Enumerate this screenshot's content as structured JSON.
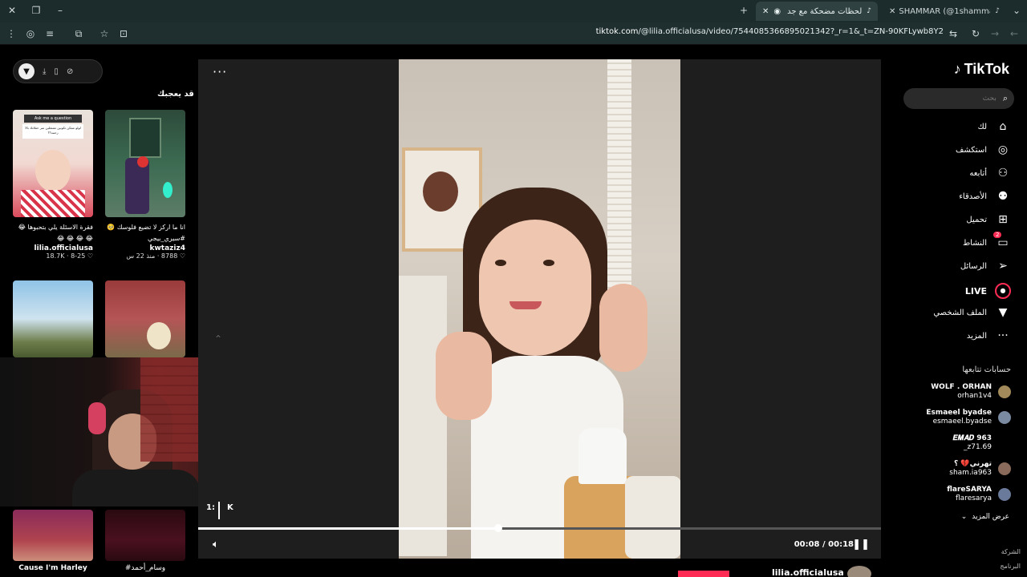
{
  "browser": {
    "tabs": [
      {
        "title": "SHAMMAR (@1shammar2) | Tik"
      },
      {
        "title": "لحظات مضحكة مع جد لولو ي"
      }
    ],
    "url_host": "tiktok.com",
    "url_path": "/@lilia.officialusa/video/7544085366895021342?_r=1&_t=ZN-90KFLywb8Y2"
  },
  "sidebar": {
    "logo": "TikTok",
    "search_placeholder": "بحث",
    "nav": [
      {
        "label": "لك",
        "icon": "home-icon"
      },
      {
        "label": "استكشف",
        "icon": "compass-icon"
      },
      {
        "label": "أتابعه",
        "icon": "user-follow-icon"
      },
      {
        "label": "الأصدقاء",
        "icon": "friends-icon"
      },
      {
        "label": "تحميل",
        "icon": "upload-icon"
      },
      {
        "label": "النشاط",
        "icon": "activity-icon",
        "badge": "2"
      },
      {
        "label": "الرسائل",
        "icon": "message-icon"
      },
      {
        "label": "LIVE",
        "icon": "live-icon"
      },
      {
        "label": "الملف الشخصي",
        "icon": "profile-icon"
      },
      {
        "label": "المزيد",
        "icon": "more-icon"
      }
    ],
    "following_title": "حسابات تتابعها",
    "accounts": [
      {
        "name": "WOLF . ORHAN",
        "handle": "orhan1v4"
      },
      {
        "name": "Esmaeel byadse",
        "handle": "esmaeel.byadse"
      },
      {
        "name": "𝑬𝑴𝑨𝑫 963",
        "handle": "_z71.69"
      },
      {
        "name": "تهرني💔 ؟",
        "handle": "sham.ia963"
      },
      {
        "name": "flareSARYA",
        "handle": "flaresarya"
      }
    ],
    "see_more": "عرض المزيد",
    "footer": [
      "الشركة",
      "البرنامج"
    ]
  },
  "player": {
    "current_time": "00:08",
    "duration": "00:18",
    "progress": 0.44,
    "author": "lilia.officialusa",
    "overlay_text": "1:",
    "overlay_text2": "K"
  },
  "recommended": {
    "title": "قد يعجبك",
    "cards": [
      {
        "caption": "انا ما اركز لا تضيع فلوسك 🥺 #سيري_بيجي",
        "user": "kwtaziz4",
        "likes": "8788",
        "meta": "منذ 22 س"
      },
      {
        "caption": "فقرة الاسئلة يلي بتحبوها 😂 😂 😂 😂 😂",
        "user": "lilia.officialusa",
        "likes": "18.7K",
        "meta": "8-25"
      }
    ],
    "bottom_captions": [
      {
        "text": "Cause I'm Harley"
      },
      {
        "text": "#وسام_أحمد"
      }
    ],
    "thumb_text": {
      "ask": "Ask me a question",
      "question": "لولو ممكن تكونين تشتغلين سر حفلاتك بالا زحمة؟؟"
    }
  },
  "colors": {
    "accent": "#fe2c55",
    "bg": "#000000",
    "panel": "#1e1e1e"
  }
}
